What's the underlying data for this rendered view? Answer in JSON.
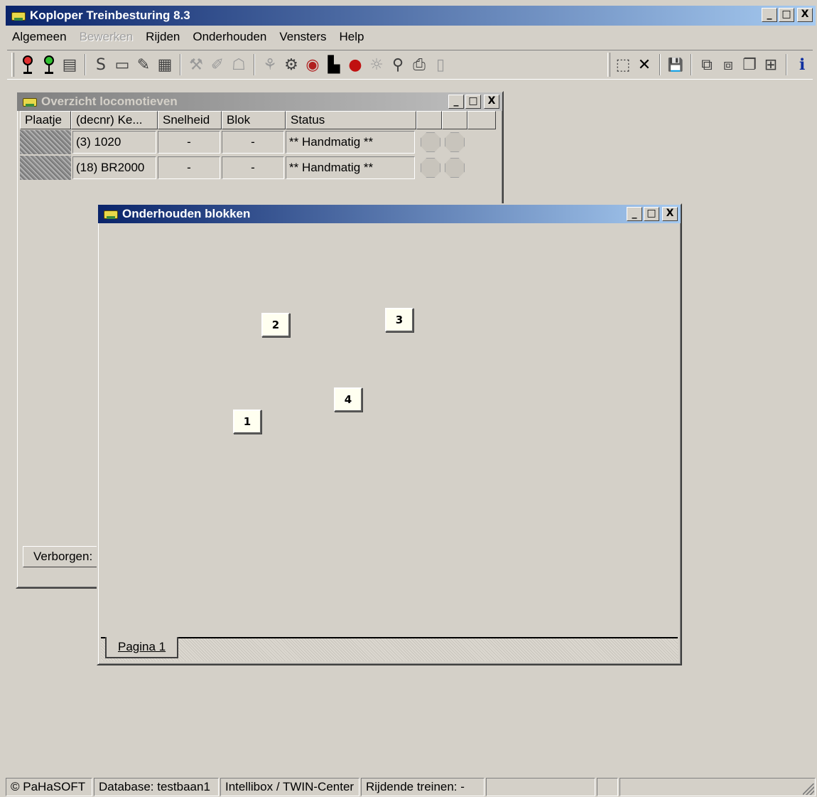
{
  "app": {
    "title": "Koploper Treinbesturing 8.3",
    "title_buttons": [
      "_",
      "□",
      "X"
    ]
  },
  "menu": {
    "items": [
      {
        "label": "Algemeen",
        "enabled": true
      },
      {
        "label": "Bewerken",
        "enabled": false
      },
      {
        "label": "Rijden",
        "enabled": true
      },
      {
        "label": "Onderhouden",
        "enabled": true
      },
      {
        "label": "Vensters",
        "enabled": true
      },
      {
        "label": "Help",
        "enabled": true
      }
    ]
  },
  "toolbar": {
    "icons_left": [
      "signal-red-icon",
      "signal-green-icon",
      "keyboard-icon",
      "s-icon",
      "block-icon",
      "edit-icon",
      "grid-icon",
      "sensor-icon",
      "brush-icon",
      "ghost-icon",
      "route-icon",
      "gear-icon",
      "speaker-icon",
      "locomotive-icon",
      "stop-icon",
      "light-icon",
      "key-icon",
      "print-icon",
      "page-icon"
    ],
    "glyphs_left": [
      "",
      "",
      "▤",
      "S",
      "▭",
      "✎",
      "▦",
      "⚒",
      "✐",
      "☖",
      "⚘",
      "⚙",
      "◉",
      "▙",
      "●",
      "☼",
      "⚲",
      "⎙",
      "▯"
    ],
    "icons_right": [
      "new-window-icon",
      "close-icon",
      "save-icon",
      "cascade-icon",
      "tile-icon",
      "stack-icon",
      "arrange-icon",
      "info-icon"
    ],
    "glyphs_right": [
      "⬚",
      "✕",
      "💾",
      "⧉",
      "⧈",
      "❐",
      "⊞",
      "ℹ"
    ]
  },
  "loco_window": {
    "title": "Overzicht locomotieven",
    "columns": [
      "Plaatje",
      "(decnr) Ke...",
      "Snelheid",
      "Blok",
      "Status",
      "",
      ""
    ],
    "rows": [
      {
        "name": "(3) 1020",
        "speed": "-",
        "block": "-",
        "status": "** Handmatig **"
      },
      {
        "name": "(18) BR2000",
        "speed": "-",
        "block": "-",
        "status": "** Handmatig **"
      }
    ],
    "hidden_label": "Verborgen:"
  },
  "blocks_window": {
    "title": "Onderhouden blokken",
    "blocks": [
      "1",
      "2",
      "3",
      "4"
    ],
    "page_tab": "Pagina 1"
  },
  "status_bar": {
    "panes": [
      "© PaHaSOFT",
      "Database: testbaan1",
      "Intellibox / TWIN-Center",
      "Rijdende treinen: -",
      "",
      "",
      ""
    ]
  }
}
